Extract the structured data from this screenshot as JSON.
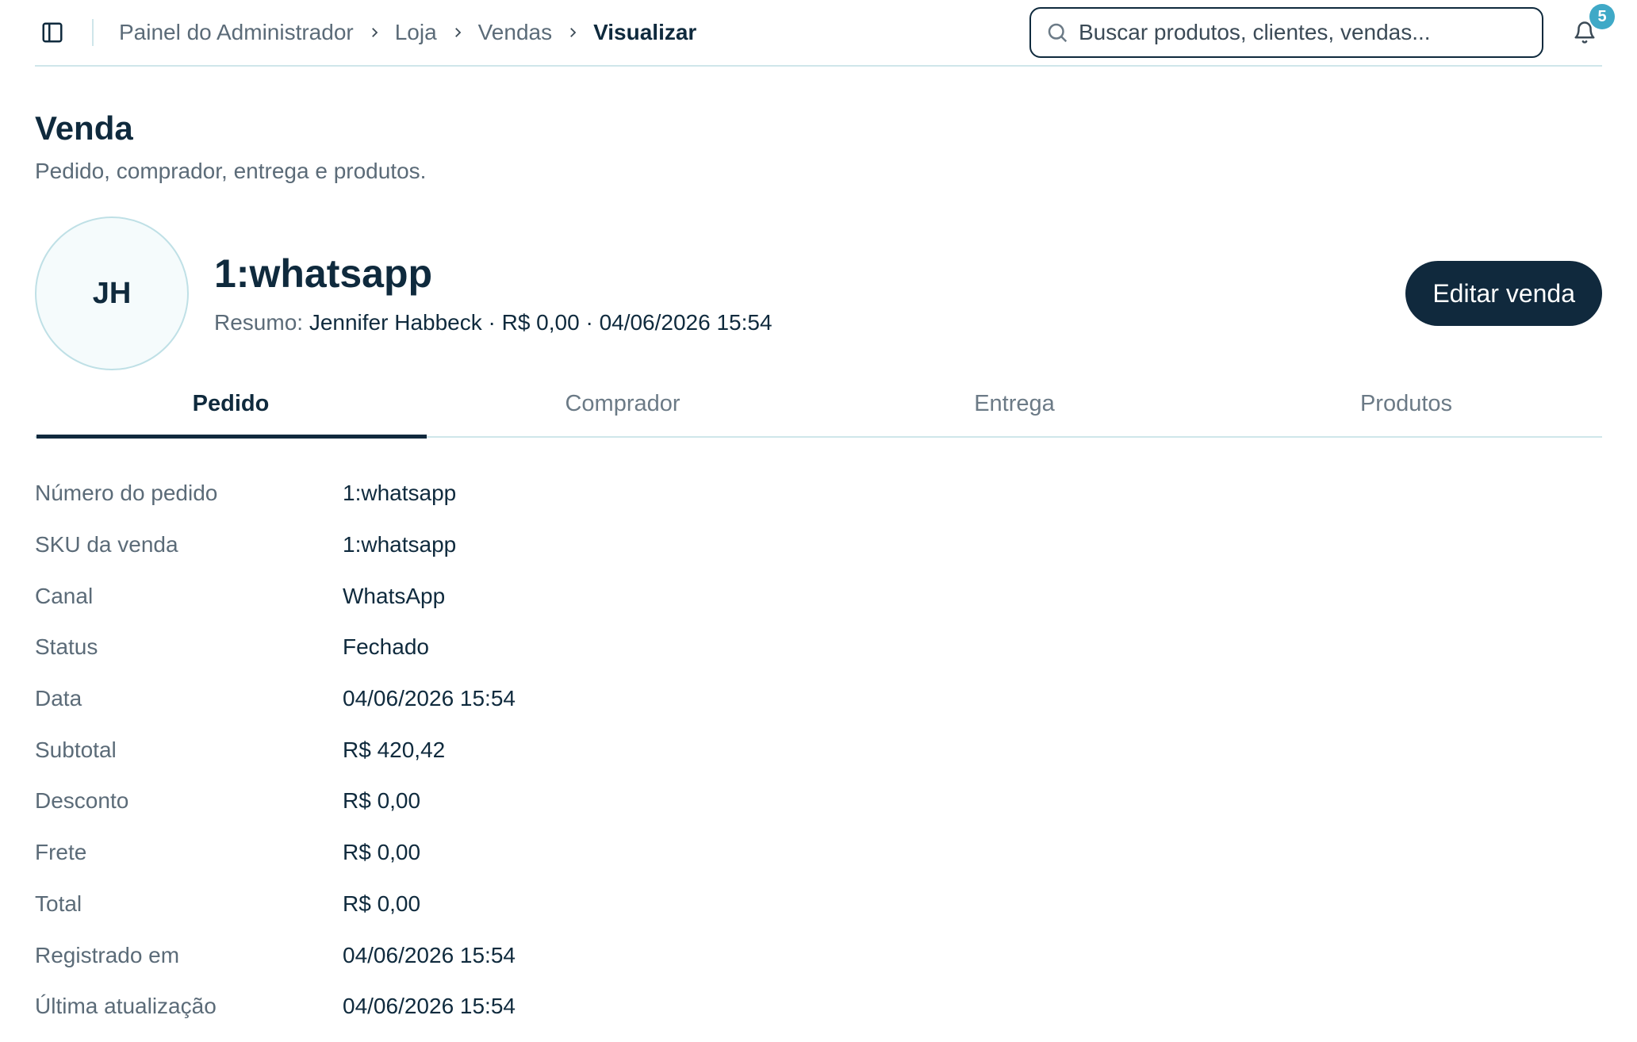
{
  "header": {
    "breadcrumb": [
      "Painel do Administrador",
      "Loja",
      "Vendas"
    ],
    "breadcrumb_current": "Visualizar",
    "search_placeholder": "Buscar produtos, clientes, vendas...",
    "notifications_count": "5"
  },
  "page": {
    "title": "Venda",
    "subtitle": "Pedido, comprador, entrega e produtos."
  },
  "summary": {
    "avatar_initials": "JH",
    "order_title": "1:whatsapp",
    "summary_label": "Resumo:",
    "summary_value": "Jennifer Habbeck · R$ 0,00 · 04/06/2026 15:54",
    "edit_button": "Editar venda"
  },
  "tabs": [
    {
      "label": "Pedido",
      "active": true
    },
    {
      "label": "Comprador",
      "active": false
    },
    {
      "label": "Entrega",
      "active": false
    },
    {
      "label": "Produtos",
      "active": false
    }
  ],
  "details": [
    {
      "label": "Número do pedido",
      "value": "1:whatsapp"
    },
    {
      "label": "SKU da venda",
      "value": "1:whatsapp"
    },
    {
      "label": "Canal",
      "value": "WhatsApp"
    },
    {
      "label": "Status",
      "value": "Fechado"
    },
    {
      "label": "Data",
      "value": "04/06/2026 15:54"
    },
    {
      "label": "Subtotal",
      "value": "R$ 420,42"
    },
    {
      "label": "Desconto",
      "value": "R$ 0,00"
    },
    {
      "label": "Frete",
      "value": "R$ 0,00"
    },
    {
      "label": "Total",
      "value": "R$ 0,00"
    },
    {
      "label": "Registrado em",
      "value": "04/06/2026 15:54"
    },
    {
      "label": "Última atualização",
      "value": "04/06/2026 15:54"
    }
  ],
  "icons": {
    "sidebar_toggle": "sidebar-icon",
    "separator": "chevron-right-icon",
    "search": "search-icon",
    "notifications": "bell-icon"
  },
  "colors": {
    "primary": "#10293d",
    "accent": "#3fa9c7",
    "border": "#cfe6ea",
    "muted_text": "#5b6b78"
  }
}
